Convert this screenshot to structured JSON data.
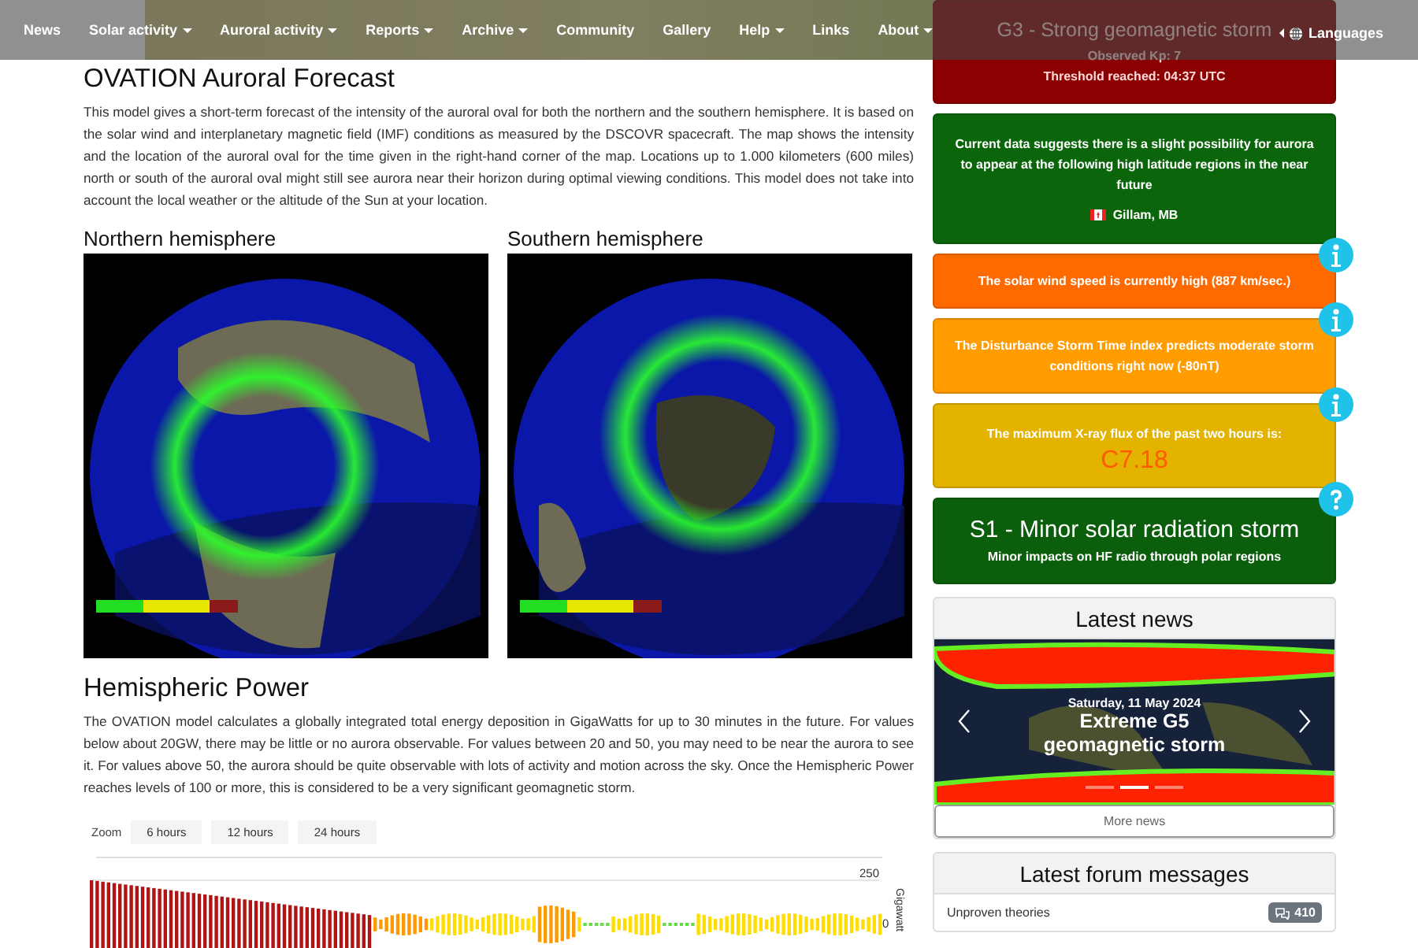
{
  "nav": {
    "items": [
      {
        "label": "News",
        "dropdown": false
      },
      {
        "label": "Solar activity",
        "dropdown": true
      },
      {
        "label": "Auroral activity",
        "dropdown": true
      },
      {
        "label": "Reports",
        "dropdown": true
      },
      {
        "label": "Archive",
        "dropdown": true
      },
      {
        "label": "Community",
        "dropdown": false
      },
      {
        "label": "Gallery",
        "dropdown": false
      },
      {
        "label": "Help",
        "dropdown": true
      },
      {
        "label": "Links",
        "dropdown": false
      },
      {
        "label": "About",
        "dropdown": true
      }
    ],
    "languages": "Languages"
  },
  "forecast": {
    "title": "OVATION Auroral Forecast",
    "text": "This model gives a short-term forecast of the intensity of the auroral oval for both the northern and the southern hemisphere. It is based on the solar wind and interplanetary magnetic field (IMF) conditions as measured by the DSCOVR spacecraft. The map shows the intensity and the location of the auroral oval for the time given in the right-hand corner of the map. Locations up to 1.000 kilometers (600 miles) north or south of the auroral oval might still see aurora near their horizon during optimal viewing conditions. This model does not take into account the local weather or the altitude of the Sun at your location.",
    "maps": [
      {
        "heading": "Northern hemisphere",
        "kind": "north"
      },
      {
        "heading": "Southern hemisphere",
        "kind": "south"
      }
    ]
  },
  "power": {
    "title": "Hemispheric Power",
    "text": "The OVATION model calculates a globally integrated total energy deposition in GigaWatts for up to 30 minutes in the future. For values below about 20GW, there may be little or no aurora observable. For values between 20 and 50, you may need to be near the aurora to see it. For values above 50, the aurora should be quite observable with lots of activity and motion across the sky. Once the Hemispheric Power reaches levels of 100 or more, this is considered to be a very significant geomagnetic storm.",
    "zoom_label": "Zoom",
    "zoom_buttons": [
      {
        "label": "6 hours",
        "selected": false
      },
      {
        "label": "12 hours",
        "selected": false
      },
      {
        "label": "24 hours",
        "selected": false
      }
    ],
    "tick_labels": [
      "250",
      "0"
    ],
    "axis_title": "Gigawatt"
  },
  "alerts": [
    {
      "kind": "storm",
      "color": "#8b0000",
      "title": "G3 - Strong geomagnetic storm",
      "lines": [
        "Observed Kp: 7",
        "Threshold reached: 04:37 UTC"
      ]
    },
    {
      "kind": "aurora",
      "color": "#0b650b",
      "text": "Current data suggests there is a slight possibility for aurora to appear at the following high latitude regions in the near future",
      "location": "Gillam, MB"
    },
    {
      "kind": "notice",
      "color": "#ff6a00",
      "text": "The solar wind speed is currently high (887 km/sec.)",
      "info_button": true
    },
    {
      "kind": "notice",
      "color": "#ff9c00",
      "text": "The Disturbance Storm Time index predicts moderate storm conditions right now (-80nT)",
      "info_button": true
    },
    {
      "kind": "xray",
      "color": "#e3b300",
      "text": "The maximum X-ray flux of the past two hours is:",
      "value": "C7.18",
      "info_button": true
    },
    {
      "kind": "radiation",
      "color": "#0b5e0b",
      "title": "S1 - Minor solar radiation storm",
      "text": "Minor impacts on HF radio through polar regions",
      "help_button": true
    }
  ],
  "news": {
    "title": "Latest news",
    "date": "Saturday, 11 May 2024",
    "headline": "Extreme G5 geomagnetic storm",
    "indicators": [
      {
        "selected": false
      },
      {
        "selected": true
      },
      {
        "selected": false
      }
    ],
    "more": "More news"
  },
  "forum": {
    "title": "Latest forum messages",
    "topics": [
      {
        "title": "Unproven theories",
        "count": "410"
      }
    ]
  }
}
